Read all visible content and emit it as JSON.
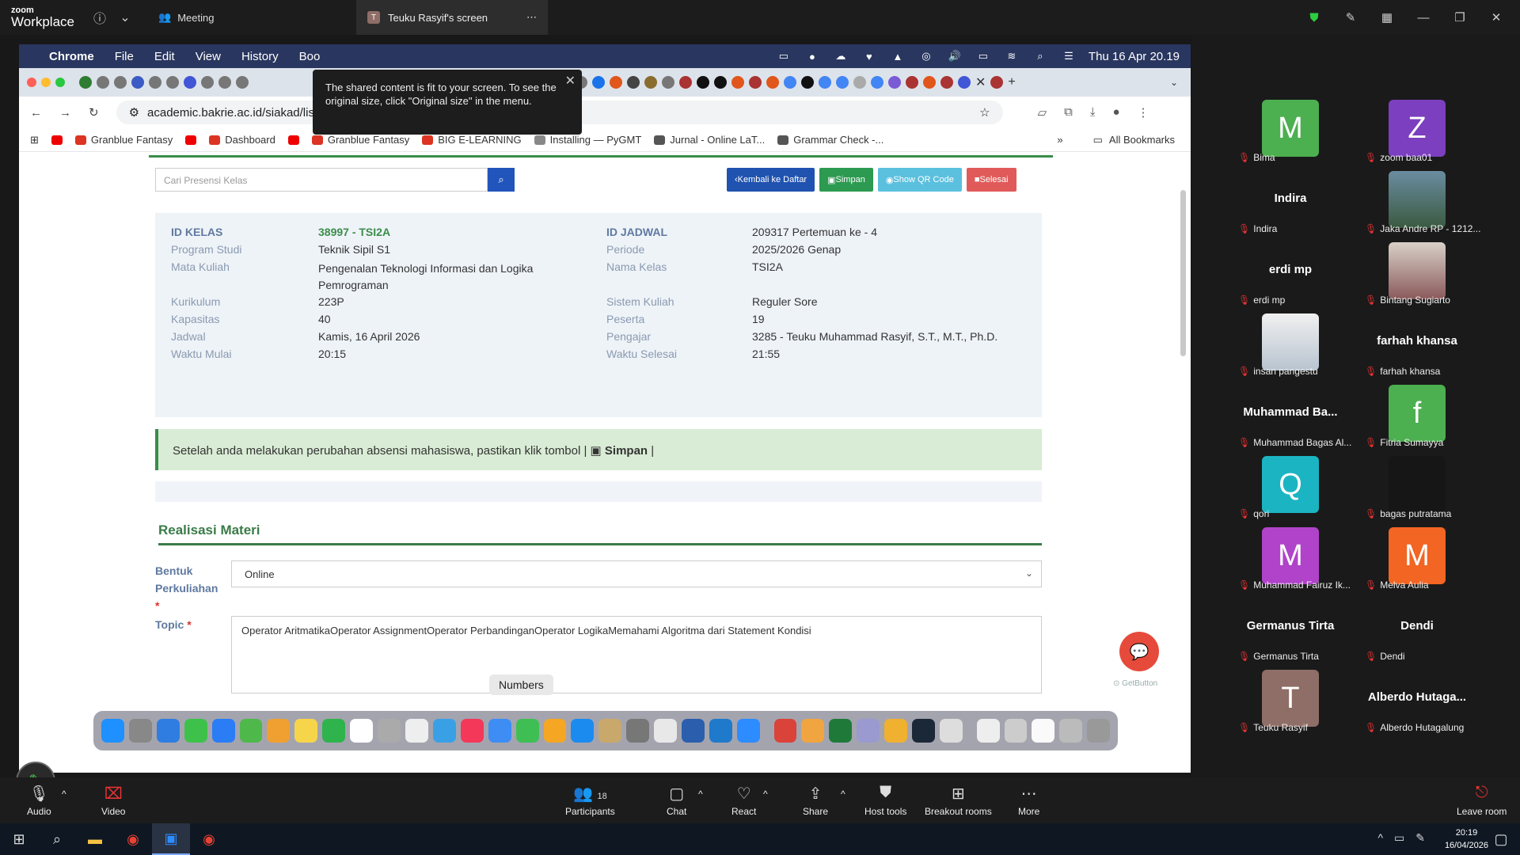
{
  "zoom_top": {
    "logo_small": "zoom",
    "logo_big": "Workplace",
    "meeting_label": "Meeting",
    "screen_tab_label": "Teuku Rasyif's screen",
    "screen_tab_initial": "T"
  },
  "share_tip": {
    "text": "The shared content is fit to your screen. To see the original size, click \"Original size\" in the menu."
  },
  "mac_menubar": {
    "app": "Chrome",
    "items": [
      "File",
      "Edit",
      "View",
      "History",
      "Boo"
    ],
    "datetime": "Thu 16 Apr  20.19"
  },
  "chrome": {
    "url": "academic.bakrie.ac.id/siakad/list_absenqrcode/38997/209317",
    "bookmarks": [
      "Granblue Fantasy",
      "Dashboard",
      "Granblue Fantasy",
      "BIG E-LEARNING",
      "Installing — PyGMT",
      "Jurnal - Online LaT...",
      "Grammar Check -..."
    ],
    "all_bookmarks": "All Bookmarks"
  },
  "page": {
    "search_placeholder": "Cari Presensi Kelas",
    "btn_back": "Kembali ke Daftar",
    "btn_save": "Simpan",
    "btn_qr": "Show QR Code",
    "btn_finish": "Selesai",
    "info_left": [
      {
        "label": "ID KELAS",
        "value": "38997 - TSI2A"
      },
      {
        "label": "Program Studi",
        "value": "Teknik Sipil S1"
      },
      {
        "label": "Mata Kuliah",
        "value": "Pengenalan Teknologi Informasi dan Logika Pemrograman"
      },
      {
        "label": "Kurikulum",
        "value": "223P"
      },
      {
        "label": "Kapasitas",
        "value": "40"
      },
      {
        "label": "Jadwal",
        "value": "Kamis, 16 April 2026"
      },
      {
        "label": "Waktu Mulai",
        "value": "20:15"
      }
    ],
    "info_right": [
      {
        "label": "ID JADWAL",
        "value": "209317 Pertemuan ke - 4"
      },
      {
        "label": "Periode",
        "value": "2025/2026 Genap"
      },
      {
        "label": "Nama Kelas",
        "value": "TSI2A"
      },
      {
        "label": "Sistem Kuliah",
        "value": "Reguler Sore"
      },
      {
        "label": "Peserta",
        "value": "19"
      },
      {
        "label": "Pengajar",
        "value": "3285 - Teuku Muhammad Rasyif, S.T., M.T., Ph.D."
      },
      {
        "label": "Waktu Selesai",
        "value": "21:55"
      }
    ],
    "alert_text": "Setelah anda melakukan perubahan absensi mahasiswa, pastikan klik tombol |",
    "alert_bold": "Simpan",
    "alert_tail": "|",
    "section_title": "Realisasi Materi",
    "field_bentuk_line1": "Bentuk",
    "field_bentuk_line2": "Perkuliahan",
    "field_bentuk_value": "Online",
    "field_topic_label": "Topic",
    "field_topic_value": "Operator AritmatikaOperator AssignmentOperator PerbandinganOperator LogikaMemahami Algoritma dari Statement Kondisi",
    "getbutton": "GetButton"
  },
  "dock_tooltip": "Numbers",
  "participants": [
    {
      "display": "M",
      "name": "Bima",
      "color": "#4caf50"
    },
    {
      "display": "Z",
      "name": "zoom baa01",
      "color": "#7b3fbf"
    },
    {
      "display": "Indira",
      "name": "Indira",
      "color": ""
    },
    {
      "display": "",
      "name": "Jaka Andre RP - 1212...",
      "color": ""
    },
    {
      "display": "erdi mp",
      "name": "erdi mp",
      "color": ""
    },
    {
      "display": "",
      "name": "Bintang Sugiarto",
      "color": ""
    },
    {
      "display": "",
      "name": "insan pangestu",
      "color": ""
    },
    {
      "display": "farhah khansa",
      "name": "farhah khansa",
      "color": ""
    },
    {
      "display": "Muhammad  Ba...",
      "name": "Muhammad Bagas Al...",
      "color": ""
    },
    {
      "display": "f",
      "name": "Fitria Sumayya",
      "color": "#4caf50"
    },
    {
      "display": "Q",
      "name": "qori",
      "color": "#1bb4c2"
    },
    {
      "display": "",
      "name": "bagas putratama",
      "color": ""
    },
    {
      "display": "M",
      "name": "Muhammad Fairuz Ik...",
      "color": "#b043c9"
    },
    {
      "display": "M",
      "name": "Melva Aulia",
      "color": "#f26522"
    },
    {
      "display": "Germanus Tirta",
      "name": "Germanus Tirta",
      "color": ""
    },
    {
      "display": "Dendi",
      "name": "Dendi",
      "color": ""
    },
    {
      "display": "T",
      "name": "Teuku Rasyif",
      "color": "#8e6e66"
    },
    {
      "display": "Alberdo  Hutaga...",
      "name": "Alberdo Hutagalung",
      "color": ""
    }
  ],
  "zoom_bottom": {
    "audio": "Audio",
    "video": "Video",
    "participants": "Participants",
    "participants_count": "18",
    "chat": "Chat",
    "react": "React",
    "share": "Share",
    "host_tools": "Host tools",
    "breakout": "Breakout rooms",
    "more": "More",
    "leave": "Leave room"
  },
  "taskbar": {
    "time": "20:19",
    "date": "16/04/2026"
  }
}
